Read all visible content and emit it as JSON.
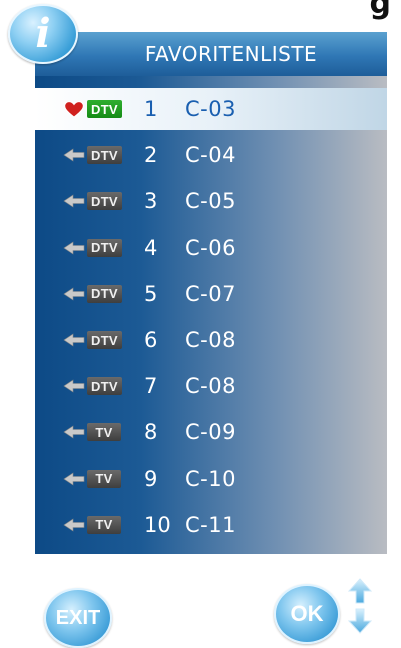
{
  "corner_text": "g",
  "header": {
    "title": "FAVORITENLISTE",
    "badge_glyph": "i"
  },
  "colors": {
    "selected_text": "#1a5fb0",
    "selected_badge": "#1e9a1e",
    "badge_default": "#4a4a4a",
    "heart": "#d0211f"
  },
  "channels": [
    {
      "icon": "heart-icon",
      "type": "DTV",
      "number": "1",
      "name": "C-03",
      "selected": true
    },
    {
      "icon": "arrow-icon",
      "type": "DTV",
      "number": "2",
      "name": "C-04",
      "selected": false
    },
    {
      "icon": "arrow-icon",
      "type": "DTV",
      "number": "3",
      "name": "C-05",
      "selected": false
    },
    {
      "icon": "arrow-icon",
      "type": "DTV",
      "number": "4",
      "name": "C-06",
      "selected": false
    },
    {
      "icon": "arrow-icon",
      "type": "DTV",
      "number": "5",
      "name": "C-07",
      "selected": false
    },
    {
      "icon": "arrow-icon",
      "type": "DTV",
      "number": "6",
      "name": "C-08",
      "selected": false
    },
    {
      "icon": "arrow-icon",
      "type": "DTV",
      "number": "7",
      "name": "C-08",
      "selected": false
    },
    {
      "icon": "arrow-icon",
      "type": "TV",
      "number": "8",
      "name": "C-09",
      "selected": false
    },
    {
      "icon": "arrow-icon",
      "type": "TV",
      "number": "9",
      "name": "C-10",
      "selected": false
    },
    {
      "icon": "arrow-icon",
      "type": "TV",
      "number": "10",
      "name": "C-11",
      "selected": false
    }
  ],
  "footer": {
    "exit_label": "EXIT",
    "ok_label": "OK",
    "up_icon": "arrow-up-icon",
    "down_icon": "arrow-down-icon"
  }
}
